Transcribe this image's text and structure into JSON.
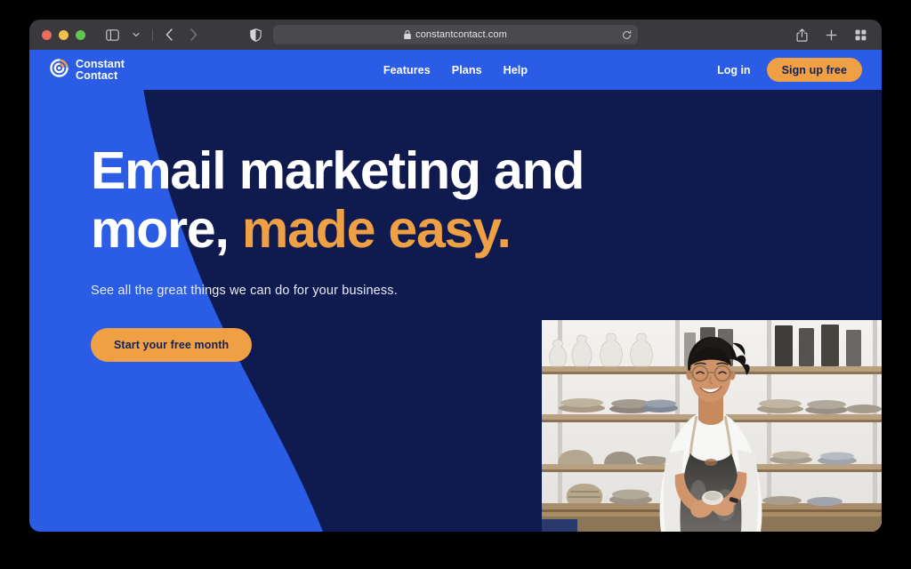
{
  "browser": {
    "traffic_lights": [
      "close",
      "minimize",
      "zoom"
    ],
    "sidebar_toggle_label": "Show sidebar",
    "tab_overview_chevron_label": "Tab options",
    "back_label": "Back",
    "forward_label": "Forward",
    "shield_label": "Privacy report",
    "url": "constantcontact.com",
    "lock_label": "Secure connection",
    "reload_label": "Reload page",
    "share_label": "Share",
    "new_tab_label": "New tab",
    "tab_overview_label": "Tab overview"
  },
  "site": {
    "logo": {
      "line1": "Constant",
      "line2": "Contact",
      "icon": "constant-contact-swirl-icon"
    },
    "nav": [
      {
        "label": "Features"
      },
      {
        "label": "Plans"
      },
      {
        "label": "Help"
      }
    ],
    "login_label": "Log in",
    "signup_label": "Sign up free"
  },
  "hero": {
    "heading_line1": "Email marketing and",
    "heading_line2_plain": "more, ",
    "heading_line2_accent": "made easy.",
    "subheading": "See all the great things we can do for your business.",
    "cta_label": "Start your free month",
    "image_alt": "Smiling potter in apron standing in a ceramics studio with shelves of pottery"
  },
  "colors": {
    "brand_blue": "#2a5ce5",
    "navy": "#0f1a4f",
    "orange": "#efa045",
    "white": "#ffffff",
    "toolbar_gray": "#3a3a3c"
  }
}
